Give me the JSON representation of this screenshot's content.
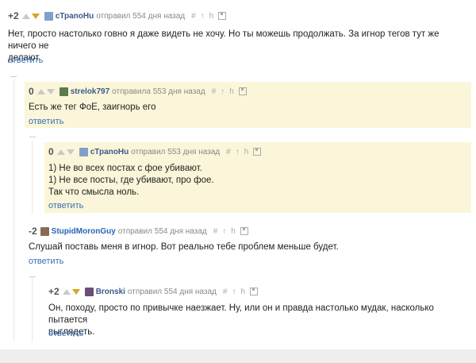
{
  "comments": [
    {
      "score": "+2",
      "user": "сТраnоНu",
      "meta": "отправил 554 дня назад",
      "lines": [
        "Нет, просто настолько говно я даже видеть не хочу. Но ты можешь продолжать. За игнор тегов тут же ничего не",
        "делают."
      ],
      "reply": "ответить"
    },
    {
      "score": "0",
      "user": "strelok797",
      "meta": "отправила 553 дня назад",
      "lines": [
        "Есть же тег ФоЕ, заигнорь его"
      ],
      "reply": "ответить"
    },
    {
      "score": "0",
      "user": "сТраnоНu",
      "meta": "отправил 553 дня назад",
      "lines": [
        "1) Не во всех постах с фое убивают.",
        "1) Не все посты, где убивают, про фое.",
        "Так что смысла ноль."
      ],
      "reply": "ответить"
    },
    {
      "score": "-2",
      "user": "StupidMoronGuy",
      "meta": "отправил 554 дня назад",
      "lines": [
        "Слушай поставь меня в игнор. Вот реально тебе проблем меньше будет."
      ],
      "reply": "ответить"
    },
    {
      "score": "+2",
      "user": "Bronski",
      "meta": "отправил 554 дня назад",
      "lines": [
        "Он, походу, просто по привычке наезжает. Ну, или он и правда настолько мудак, насколько пытается",
        "выглядеть."
      ],
      "reply": "ответить"
    }
  ],
  "icons": {
    "hash": "#",
    "up": "↑",
    "branch": "h"
  },
  "colors": {
    "highlight": "#fbf6d9",
    "link": "#3b6fb6",
    "downvote_active": "#d6a528"
  }
}
